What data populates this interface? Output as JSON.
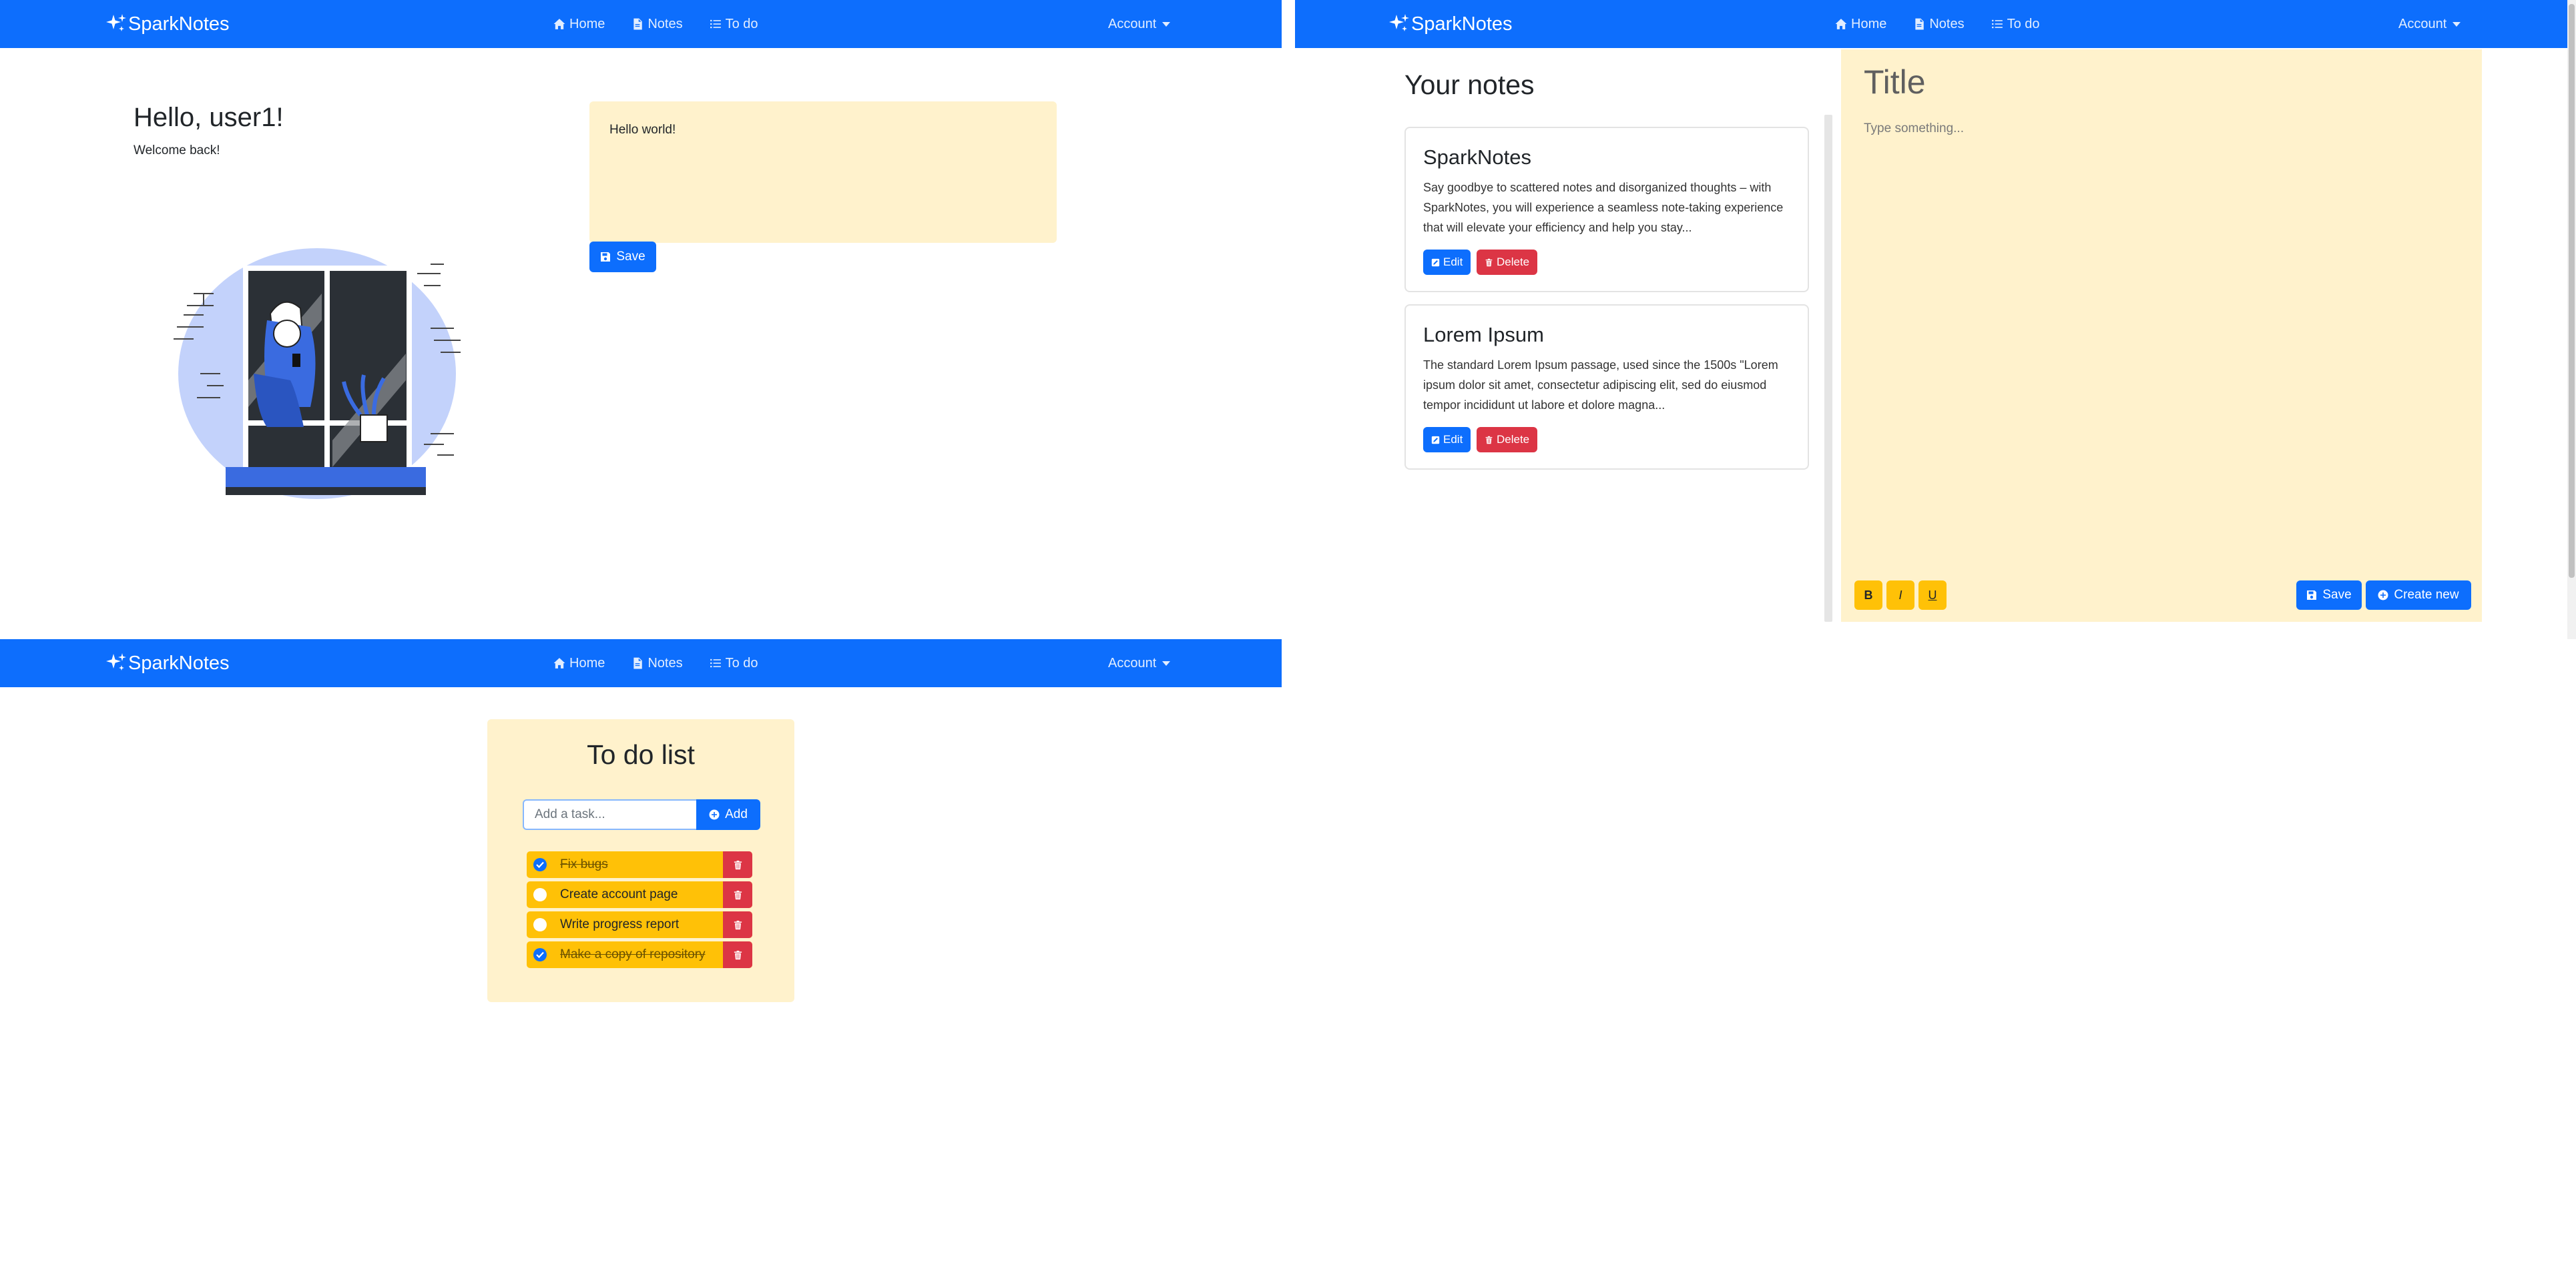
{
  "navbar": {
    "brand": "SparkNotes",
    "links": [
      "Home",
      "Notes",
      "To do"
    ],
    "account": "Account"
  },
  "home": {
    "greeting": "Hello, user1!",
    "welcome": "Welcome back!",
    "note_text": "Hello world!",
    "save_label": "Save"
  },
  "notes": {
    "heading": "Your notes",
    "items": [
      {
        "title": "SparkNotes",
        "excerpt": "Say goodbye to scattered notes and disorganized thoughts – with SparkNotes, you will experience a seamless note-taking experience that will elevate your efficiency and help you stay...",
        "edit": "Edit",
        "delete": "Delete"
      },
      {
        "title": "Lorem Ipsum",
        "excerpt": "The standard Lorem Ipsum passage, used since the 1500s \"Lorem ipsum dolor sit amet, consectetur adipiscing elit, sed do eiusmod tempor incididunt ut labore et dolore magna...",
        "edit": "Edit",
        "delete": "Delete"
      }
    ],
    "editor": {
      "title_placeholder": "Title",
      "body_placeholder": "Type something...",
      "bold": "B",
      "italic": "I",
      "underline": "U",
      "save_label": "Save",
      "create_label": "Create new"
    }
  },
  "todo": {
    "heading": "To do list",
    "input_placeholder": "Add a task...",
    "add_label": "Add",
    "tasks": [
      {
        "text": "Fix bugs",
        "done": true
      },
      {
        "text": "Create account page",
        "done": false
      },
      {
        "text": "Write progress report",
        "done": false
      },
      {
        "text": "Make a copy of repository",
        "done": true
      }
    ]
  },
  "colors": {
    "primary": "#0d6efd",
    "danger": "#dc3545",
    "warning": "#ffc107",
    "note_bg": "#fff2cc"
  }
}
